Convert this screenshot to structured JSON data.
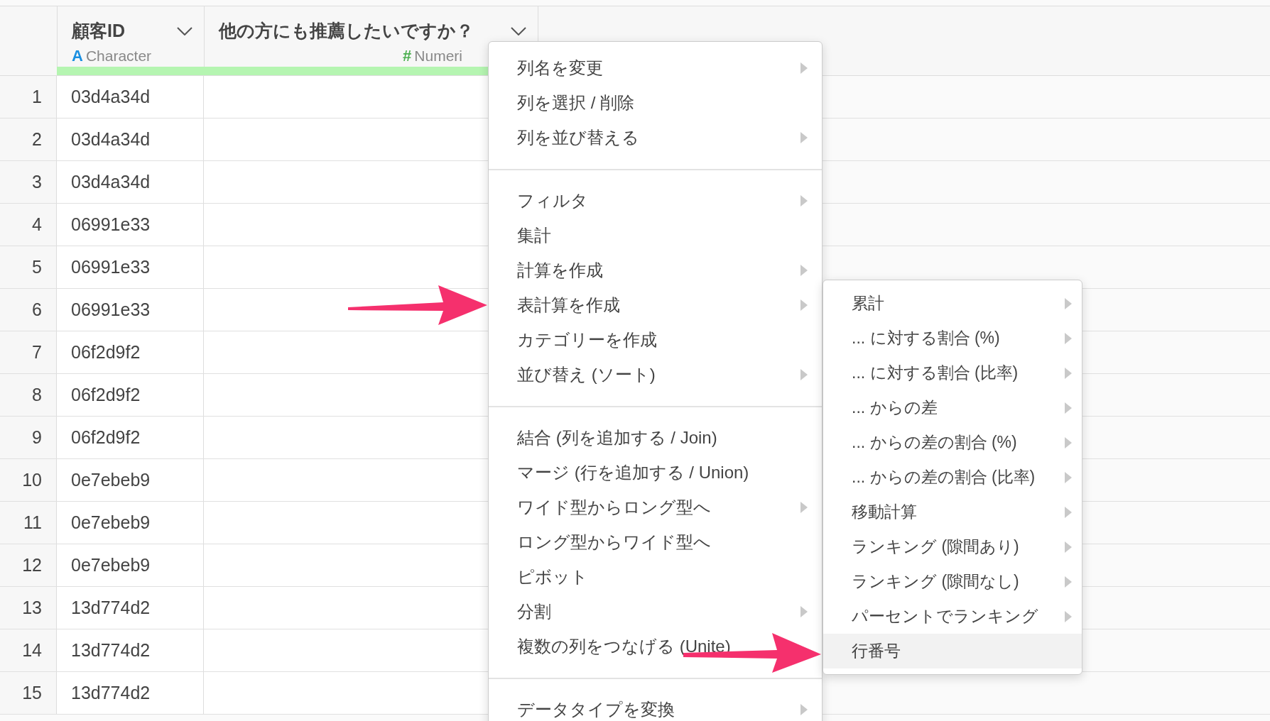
{
  "table": {
    "columns": [
      {
        "name": "顧客ID",
        "type_icon": "A",
        "type": "Character",
        "kind": "character"
      },
      {
        "name": "他の方にも推薦したいですか？",
        "type_icon": "#",
        "type": "Numeri",
        "kind": "numeric"
      }
    ],
    "rows": [
      {
        "num": "1",
        "id": "03d4a34d"
      },
      {
        "num": "2",
        "id": "03d4a34d"
      },
      {
        "num": "3",
        "id": "03d4a34d"
      },
      {
        "num": "4",
        "id": "06991e33"
      },
      {
        "num": "5",
        "id": "06991e33"
      },
      {
        "num": "6",
        "id": "06991e33"
      },
      {
        "num": "7",
        "id": "06f2d9f2"
      },
      {
        "num": "8",
        "id": "06f2d9f2"
      },
      {
        "num": "9",
        "id": "06f2d9f2"
      },
      {
        "num": "10",
        "id": "0e7ebeb9"
      },
      {
        "num": "11",
        "id": "0e7ebeb9"
      },
      {
        "num": "12",
        "id": "0e7ebeb9"
      },
      {
        "num": "13",
        "id": "13d774d2"
      },
      {
        "num": "14",
        "id": "13d774d2"
      },
      {
        "num": "15",
        "id": "13d774d2"
      }
    ]
  },
  "context_menu": {
    "groups": [
      {
        "items": [
          {
            "label": "列名を変更",
            "submenu": true
          },
          {
            "label": "列を選択 / 削除",
            "submenu": false
          },
          {
            "label": "列を並び替える",
            "submenu": true
          }
        ]
      },
      {
        "items": [
          {
            "label": "フィルタ",
            "submenu": true
          },
          {
            "label": "集計",
            "submenu": false
          },
          {
            "label": "計算を作成",
            "submenu": true
          },
          {
            "label": "表計算を作成",
            "submenu": true
          },
          {
            "label": "カテゴリーを作成",
            "submenu": false
          },
          {
            "label": "並び替え (ソート)",
            "submenu": true
          }
        ]
      },
      {
        "items": [
          {
            "label": "結合 (列を追加する / Join)",
            "submenu": false
          },
          {
            "label": "マージ (行を追加する / Union)",
            "submenu": false
          },
          {
            "label": "ワイド型からロング型へ",
            "submenu": true
          },
          {
            "label": "ロング型からワイド型へ",
            "submenu": false
          },
          {
            "label": "ピボット",
            "submenu": false
          },
          {
            "label": "分割",
            "submenu": true
          },
          {
            "label": "複数の列をつなげる (Unite)",
            "submenu": false
          }
        ]
      },
      {
        "items": [
          {
            "label": "データタイプを変換",
            "submenu": true
          }
        ]
      }
    ]
  },
  "submenu": {
    "items": [
      {
        "label": "累計",
        "submenu": true,
        "selected": false
      },
      {
        "label": "... に対する割合 (%)",
        "submenu": true,
        "selected": false
      },
      {
        "label": "... に対する割合 (比率)",
        "submenu": true,
        "selected": false
      },
      {
        "label": "... からの差",
        "submenu": true,
        "selected": false
      },
      {
        "label": "... からの差の割合 (%)",
        "submenu": true,
        "selected": false
      },
      {
        "label": "... からの差の割合 (比率)",
        "submenu": true,
        "selected": false
      },
      {
        "label": "移動計算",
        "submenu": true,
        "selected": false
      },
      {
        "label": "ランキング (隙間あり)",
        "submenu": true,
        "selected": false
      },
      {
        "label": "ランキング (隙間なし)",
        "submenu": true,
        "selected": false
      },
      {
        "label": "パーセントでランキング",
        "submenu": true,
        "selected": false
      },
      {
        "label": "行番号",
        "submenu": false,
        "selected": true
      }
    ]
  }
}
